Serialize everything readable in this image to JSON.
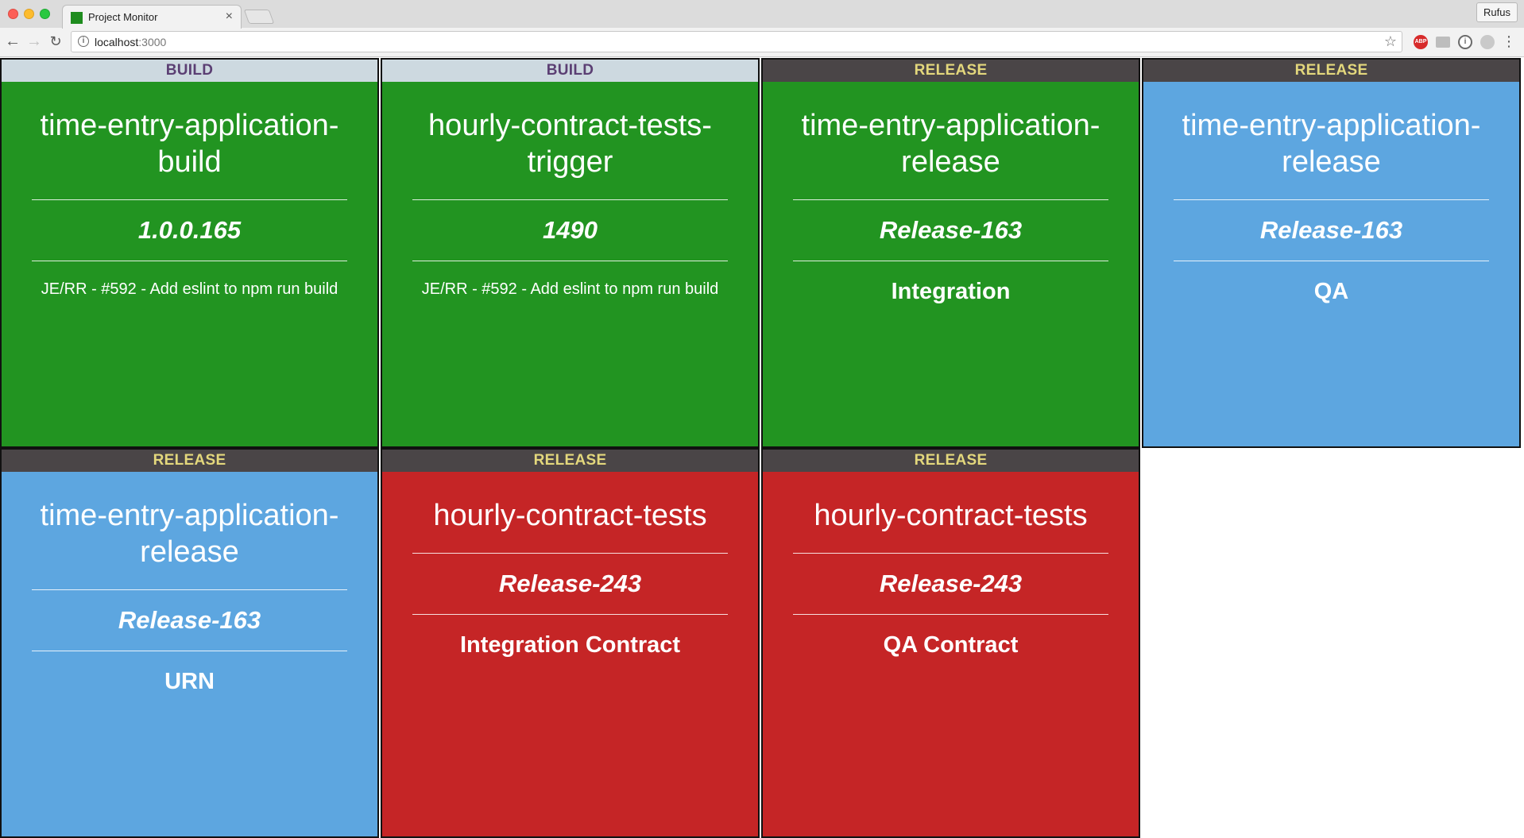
{
  "browser": {
    "tab_title": "Project Monitor",
    "tab_close": "×",
    "profile_name": "Rufus",
    "url_host": "localhost",
    "url_port": ":3000",
    "icons": [
      "back-arrow-icon",
      "forward-arrow-icon",
      "reload-icon",
      "info-icon",
      "star-icon",
      "adblock-icon",
      "extension-icon",
      "menu-dots-icon"
    ]
  },
  "colors": {
    "success": "#229421",
    "building": "#5da6e0",
    "failure": "#c52526",
    "build_header_bg": "#cdd9e0",
    "build_header_text": "#5b3f73",
    "release_header_bg": "#4a4547",
    "release_header_text": "#e3d77c"
  },
  "tiles": [
    {
      "type": "BUILD",
      "status": "success",
      "name": "time-entry-application-build",
      "version": "1.0.0.165",
      "detail": "JE/RR - #592 - Add eslint to npm run build"
    },
    {
      "type": "BUILD",
      "status": "success",
      "name": "hourly-contract-tests-trigger",
      "version": "1490",
      "detail": "JE/RR - #592 - Add eslint to npm run build"
    },
    {
      "type": "RELEASE",
      "status": "success",
      "name": "time-entry-application-release",
      "version": "Release-163",
      "detail": "Integration"
    },
    {
      "type": "RELEASE",
      "status": "building",
      "name": "time-entry-application-release",
      "version": "Release-163",
      "detail": "QA"
    },
    {
      "type": "RELEASE",
      "status": "building",
      "name": "time-entry-application-release",
      "version": "Release-163",
      "detail": "URN"
    },
    {
      "type": "RELEASE",
      "status": "failure",
      "name": "hourly-contract-tests",
      "version": "Release-243",
      "detail": "Integration Contract"
    },
    {
      "type": "RELEASE",
      "status": "failure",
      "name": "hourly-contract-tests",
      "version": "Release-243",
      "detail": "QA Contract"
    }
  ]
}
